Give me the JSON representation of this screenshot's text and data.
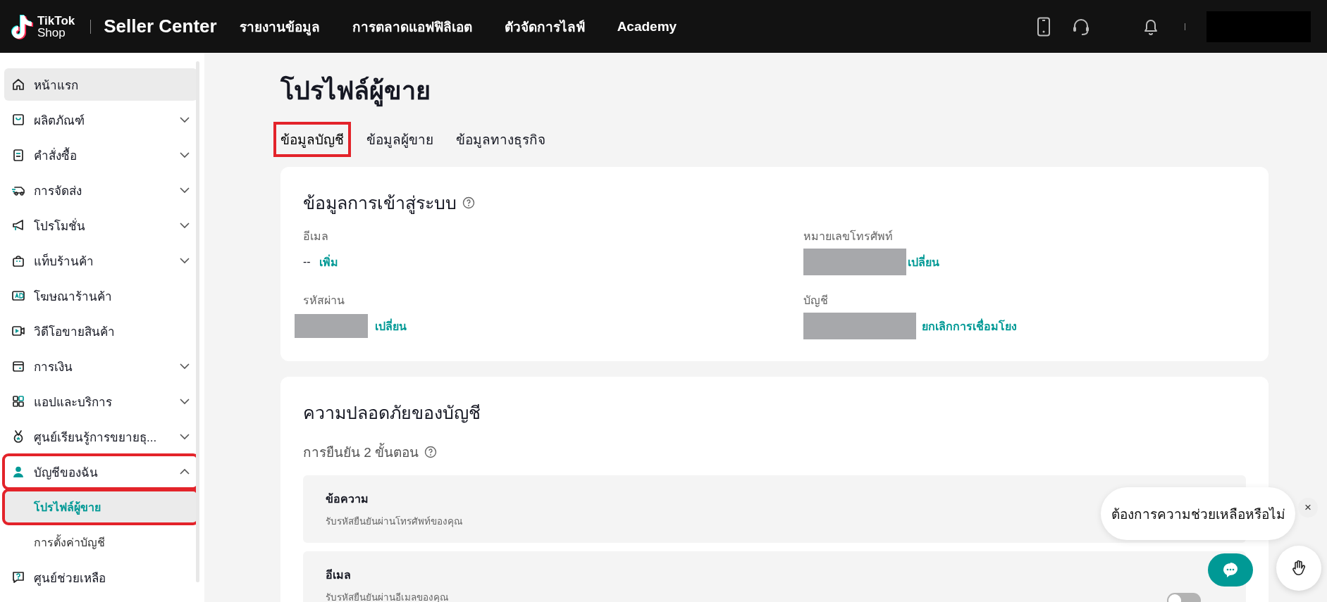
{
  "header": {
    "logo": [
      "TikTok",
      "Shop"
    ],
    "product": "Seller Center",
    "nav": [
      "รายงานข้อมูล",
      "การตลาดแอฟฟิลิเอต",
      "ตัวจัดการไลฟ์",
      "Academy"
    ],
    "account_hidden": true
  },
  "sidebar": {
    "items": [
      {
        "label": "หน้าแรก",
        "hovered": true,
        "annotated": false
      },
      {
        "label": "ผลิตภัณฑ์",
        "expanded": false,
        "hovered": false,
        "annotated": false
      },
      {
        "label": "คำสั่งซื้อ",
        "expanded": false,
        "hovered": false,
        "annotated": false
      },
      {
        "label": "การจัดส่ง",
        "expanded": false,
        "hovered": false,
        "annotated": false
      },
      {
        "label": "โปรโมชั่น",
        "expanded": false,
        "hovered": false,
        "annotated": false
      },
      {
        "label": "แท็บร้านค้า",
        "expanded": false,
        "hovered": false,
        "annotated": false
      },
      {
        "label": "โฆษณาร้านค้า",
        "hovered": false,
        "annotated": false
      },
      {
        "label": "วิดีโอขายสินค้า",
        "hovered": false,
        "annotated": false
      },
      {
        "label": "การเงิน",
        "expanded": false,
        "hovered": false,
        "annotated": false
      },
      {
        "label": "แอปและบริการ",
        "expanded": false,
        "hovered": false,
        "annotated": false
      },
      {
        "label": "ศูนย์เรียนรู้การขยายธุ...",
        "expanded": false,
        "hovered": false,
        "annotated": false
      },
      {
        "label": "บัญชีของฉัน",
        "expanded": true,
        "hovered": false,
        "annotated": true,
        "children": [
          {
            "label": "โปรไฟล์ผู้ขาย",
            "selected": true,
            "annotated": true
          },
          {
            "label": "การตั้งค่าบัญชี",
            "selected": false,
            "annotated": false
          }
        ]
      },
      {
        "label": "ศูนย์ช่วยเหลือ",
        "hovered": false,
        "annotated": false
      }
    ]
  },
  "page": {
    "title": "โปรไฟล์ผู้ขาย",
    "tabs": [
      {
        "label": "ข้อมูลบัญชี",
        "selected": true,
        "annotated": true
      },
      {
        "label": "ข้อมูลผู้ขาย",
        "selected": false,
        "annotated": false
      },
      {
        "label": "ข้อมูลทางธุรกิจ",
        "selected": false,
        "annotated": false
      }
    ],
    "login_card": {
      "title": "ข้อมูลการเข้าสู่ระบบ",
      "fields": [
        {
          "label": "อีเมล",
          "value": "--",
          "value_hidden": false,
          "action": "เพิ่ม"
        },
        {
          "label": "หมายเลขโทรศัพท์",
          "value_hidden": true,
          "action": "เปลี่ยน"
        },
        {
          "label": "รหัสผ่าน",
          "value_hidden": true,
          "action": "เปลี่ยน"
        },
        {
          "label": "บัญชี",
          "value_hidden": true,
          "action": "ยกเลิกการเชื่อมโยง"
        }
      ]
    },
    "security_card": {
      "title": "ความปลอดภัยของบัญชี",
      "subtitle": "การยืนยัน 2 ขั้นตอน",
      "methods": [
        {
          "title": "ข้อความ",
          "description": "รับรหัสยืนยันผ่านโทรศัพท์ของคุณ"
        },
        {
          "title": "อีเมล",
          "description": "รับรหัสยืนยันผ่านอีเมลของคุณ",
          "on": false
        }
      ]
    }
  },
  "help": {
    "bubble": "ต้องการความช่วยเหลือหรือไม่",
    "close": "×"
  }
}
